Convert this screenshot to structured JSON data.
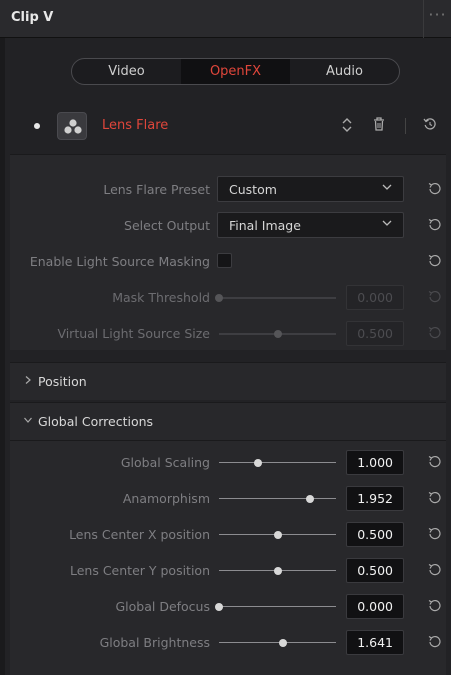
{
  "window": {
    "title": "Clip V",
    "more_glyph": "···"
  },
  "tabs": [
    {
      "label": "Video",
      "active": false
    },
    {
      "label": "OpenFX",
      "active": true
    },
    {
      "label": "Audio",
      "active": false
    }
  ],
  "effect": {
    "name": "Lens Flare",
    "accent_color": "#e0463b",
    "icons": [
      "updown-icon",
      "trash-icon",
      "reset-icon"
    ]
  },
  "params": {
    "preset": {
      "label": "Lens Flare Preset",
      "value": "Custom"
    },
    "output": {
      "label": "Select Output",
      "value": "Final Image"
    },
    "masking": {
      "label": "Enable Light Source Masking",
      "checked": false
    },
    "mask_threshold": {
      "label": "Mask Threshold",
      "value": "0.000",
      "level": 0.0,
      "enabled": false
    },
    "virtual_size": {
      "label": "Virtual Light Source Size",
      "value": "0.500",
      "level": 0.5,
      "enabled": false
    }
  },
  "sections": {
    "position": {
      "label": "Position",
      "expanded": false
    },
    "global": {
      "label": "Global Corrections",
      "expanded": true
    }
  },
  "global_params": [
    {
      "label": "Global Scaling",
      "value": "1.000",
      "level": 0.33
    },
    {
      "label": "Anamorphism",
      "value": "1.952",
      "level": 0.78
    },
    {
      "label": "Lens Center X position",
      "value": "0.500",
      "level": 0.5
    },
    {
      "label": "Lens Center Y position",
      "value": "0.500",
      "level": 0.5
    },
    {
      "label": "Global Defocus",
      "value": "0.000",
      "level": 0.0
    },
    {
      "label": "Global Brightness",
      "value": "1.641",
      "level": 0.55
    }
  ]
}
